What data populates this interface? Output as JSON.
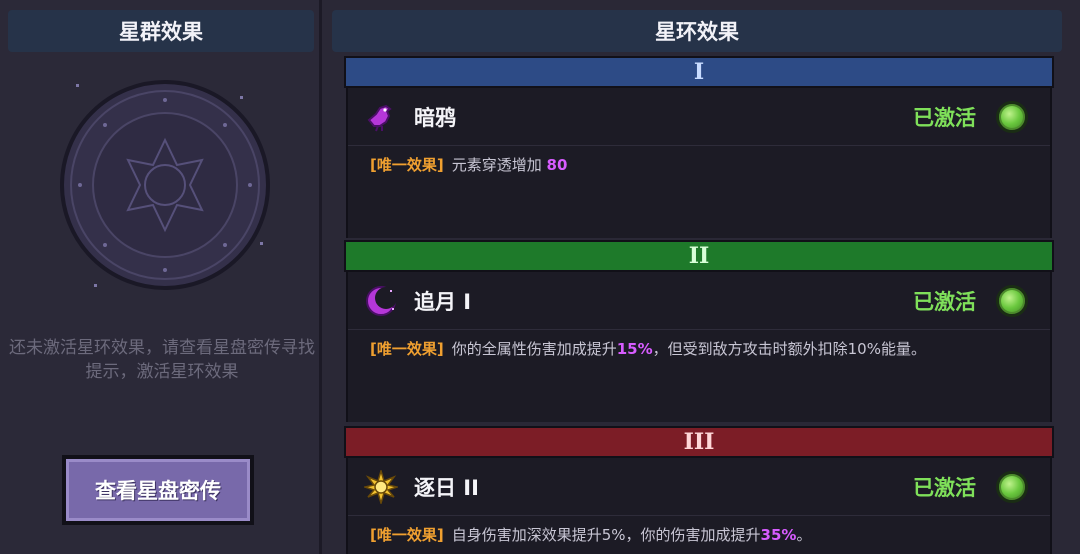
{
  "left": {
    "header": "星群效果",
    "hint": "还未激活星环效果，请查看星盘密传寻找提示，激活星环效果",
    "button_label": "查看星盘密传"
  },
  "right": {
    "header": "星环效果",
    "tiers": [
      {
        "numeral": "I",
        "color": "#2d4b86",
        "effect": {
          "name": "暗鸦",
          "icon": "purple-crow-icon",
          "status": "已激活",
          "tag": "[唯一效果]",
          "desc_before": "元素穿透增加",
          "desc_value": "80",
          "desc_after": ""
        }
      },
      {
        "numeral": "II",
        "color": "#1e7a2a",
        "effect": {
          "name": "追月 I",
          "icon": "crescent-moon-icon",
          "status": "已激活",
          "tag": "[唯一效果]",
          "desc_before": "你的全属性伤害加成提升",
          "desc_value": "15%",
          "desc_after": "，但受到敌方攻击时额外扣除10%能量。"
        }
      },
      {
        "numeral": "III",
        "color": "#7c1d26",
        "effect": {
          "name": "逐日 II",
          "icon": "golden-sun-icon",
          "status": "已激活",
          "tag": "[唯一效果]",
          "desc_before": "自身伤害加深效果提升5%，你的伤害加成提升",
          "desc_value": "35%",
          "desc_after": "。"
        }
      }
    ]
  },
  "colors": {
    "status_active": "#7fe05a",
    "tag": "#f0a030",
    "highlight": "#d75cff",
    "header_bg": "#263349"
  }
}
